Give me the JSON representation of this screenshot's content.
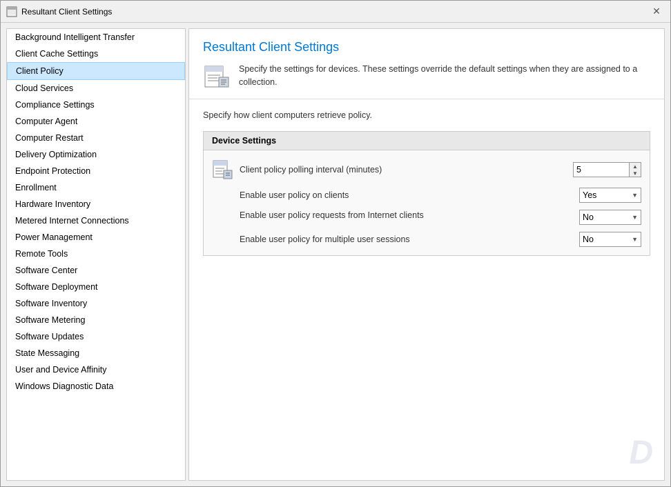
{
  "window": {
    "title": "Resultant Client Settings",
    "close_label": "✕"
  },
  "sidebar": {
    "items": [
      {
        "label": "Background Intelligent Transfer",
        "active": false
      },
      {
        "label": "Client Cache Settings",
        "active": false
      },
      {
        "label": "Client Policy",
        "active": true
      },
      {
        "label": "Cloud Services",
        "active": false
      },
      {
        "label": "Compliance Settings",
        "active": false
      },
      {
        "label": "Computer Agent",
        "active": false
      },
      {
        "label": "Computer Restart",
        "active": false
      },
      {
        "label": "Delivery Optimization",
        "active": false
      },
      {
        "label": "Endpoint Protection",
        "active": false
      },
      {
        "label": "Enrollment",
        "active": false
      },
      {
        "label": "Hardware Inventory",
        "active": false
      },
      {
        "label": "Metered Internet Connections",
        "active": false
      },
      {
        "label": "Power Management",
        "active": false
      },
      {
        "label": "Remote Tools",
        "active": false
      },
      {
        "label": "Software Center",
        "active": false
      },
      {
        "label": "Software Deployment",
        "active": false
      },
      {
        "label": "Software Inventory",
        "active": false
      },
      {
        "label": "Software Metering",
        "active": false
      },
      {
        "label": "Software Updates",
        "active": false
      },
      {
        "label": "State Messaging",
        "active": false
      },
      {
        "label": "User and Device Affinity",
        "active": false
      },
      {
        "label": "Windows Diagnostic Data",
        "active": false
      }
    ]
  },
  "main": {
    "title": "Resultant Client Settings",
    "description": "Specify the settings for devices. These settings override the default settings when they are assigned to a collection.",
    "intro": "Specify how client computers retrieve policy.",
    "device_settings_header": "Device Settings",
    "settings": [
      {
        "label": "Client policy polling interval (minutes)",
        "type": "spinbox",
        "value": "5"
      },
      {
        "label": "Enable user policy on clients",
        "type": "dropdown",
        "value": "Yes"
      },
      {
        "label": "Enable user policy requests from Internet clients",
        "type": "dropdown",
        "value": "No"
      },
      {
        "label": "Enable user policy for multiple user sessions",
        "type": "dropdown",
        "value": "No"
      }
    ]
  }
}
